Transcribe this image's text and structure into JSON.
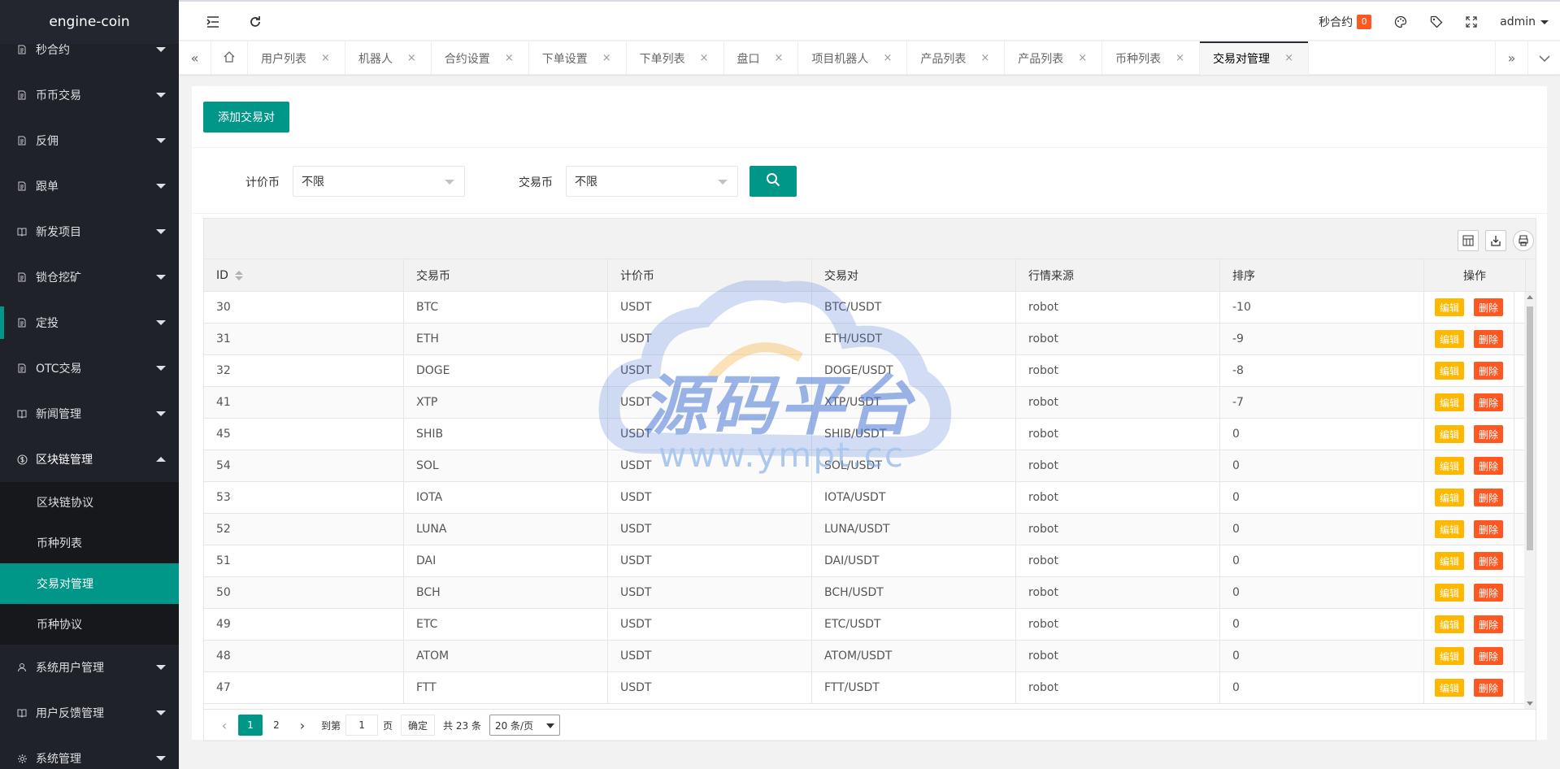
{
  "app": {
    "title": "engine-coin"
  },
  "sidebar": {
    "items": [
      {
        "label": "秒合约",
        "icon": "doc-icon"
      },
      {
        "label": "币币交易",
        "icon": "doc-icon"
      },
      {
        "label": "反佣",
        "icon": "doc-icon"
      },
      {
        "label": "跟单",
        "icon": "doc-icon"
      },
      {
        "label": "新发项目",
        "icon": "book-icon"
      },
      {
        "label": "锁仓挖矿",
        "icon": "doc-icon"
      },
      {
        "label": "定投",
        "icon": "doc-icon"
      },
      {
        "label": "OTC交易",
        "icon": "doc-icon"
      },
      {
        "label": "新闻管理",
        "icon": "book-icon"
      },
      {
        "label": "区块链管理",
        "icon": "dollar-icon"
      }
    ],
    "submenu": [
      {
        "label": "区块链协议"
      },
      {
        "label": "币种列表"
      },
      {
        "label": "交易对管理"
      },
      {
        "label": "币种协议"
      }
    ],
    "items_after": [
      {
        "label": "系统用户管理",
        "icon": "user-icon"
      },
      {
        "label": "用户反馈管理",
        "icon": "book-icon"
      },
      {
        "label": "系统管理",
        "icon": "gear-icon"
      }
    ]
  },
  "header": {
    "seconds_contract_label": "秒合约",
    "seconds_contract_badge": "0",
    "user": "admin"
  },
  "tabs": [
    {
      "label": "用户列表"
    },
    {
      "label": "机器人"
    },
    {
      "label": "合约设置"
    },
    {
      "label": "下单设置"
    },
    {
      "label": "下单列表"
    },
    {
      "label": "盘口"
    },
    {
      "label": "项目机器人"
    },
    {
      "label": "产品列表"
    },
    {
      "label": "产品列表"
    },
    {
      "label": "币种列表"
    },
    {
      "label": "交易对管理",
      "active": true
    }
  ],
  "main": {
    "add_button": "添加交易对",
    "filters": {
      "quote_label": "计价币",
      "quote_value": "不限",
      "base_label": "交易币",
      "base_value": "不限"
    }
  },
  "table": {
    "columns": [
      "ID",
      "交易币",
      "计价币",
      "交易对",
      "行情来源",
      "排序",
      "操作"
    ],
    "edit_label": "编辑",
    "delete_label": "删除",
    "rows": [
      {
        "id": "30",
        "base": "BTC",
        "quote": "USDT",
        "pair": "BTC/USDT",
        "source": "robot",
        "sort": "-10"
      },
      {
        "id": "31",
        "base": "ETH",
        "quote": "USDT",
        "pair": "ETH/USDT",
        "source": "robot",
        "sort": "-9"
      },
      {
        "id": "32",
        "base": "DOGE",
        "quote": "USDT",
        "pair": "DOGE/USDT",
        "source": "robot",
        "sort": "-8"
      },
      {
        "id": "41",
        "base": "XTP",
        "quote": "USDT",
        "pair": "XTP/USDT",
        "source": "robot",
        "sort": "-7"
      },
      {
        "id": "45",
        "base": "SHIB",
        "quote": "USDT",
        "pair": "SHIB/USDT",
        "source": "robot",
        "sort": "0"
      },
      {
        "id": "54",
        "base": "SOL",
        "quote": "USDT",
        "pair": "SOL/USDT",
        "source": "robot",
        "sort": "0"
      },
      {
        "id": "53",
        "base": "IOTA",
        "quote": "USDT",
        "pair": "IOTA/USDT",
        "source": "robot",
        "sort": "0"
      },
      {
        "id": "52",
        "base": "LUNA",
        "quote": "USDT",
        "pair": "LUNA/USDT",
        "source": "robot",
        "sort": "0"
      },
      {
        "id": "51",
        "base": "DAI",
        "quote": "USDT",
        "pair": "DAI/USDT",
        "source": "robot",
        "sort": "0"
      },
      {
        "id": "50",
        "base": "BCH",
        "quote": "USDT",
        "pair": "BCH/USDT",
        "source": "robot",
        "sort": "0"
      },
      {
        "id": "49",
        "base": "ETC",
        "quote": "USDT",
        "pair": "ETC/USDT",
        "source": "robot",
        "sort": "0"
      },
      {
        "id": "48",
        "base": "ATOM",
        "quote": "USDT",
        "pair": "ATOM/USDT",
        "source": "robot",
        "sort": "0"
      },
      {
        "id": "47",
        "base": "FTT",
        "quote": "USDT",
        "pair": "FTT/USDT",
        "source": "robot",
        "sort": "0"
      }
    ]
  },
  "pager": {
    "pages": [
      "1",
      "2"
    ],
    "current": "1",
    "goto_prefix": "到第",
    "goto_value": "1",
    "goto_suffix": "页",
    "confirm": "确定",
    "total": "共 23 条",
    "page_size": "20 条/页"
  },
  "watermark": {
    "text": "源码平台",
    "url": "www.ympt.cc"
  }
}
